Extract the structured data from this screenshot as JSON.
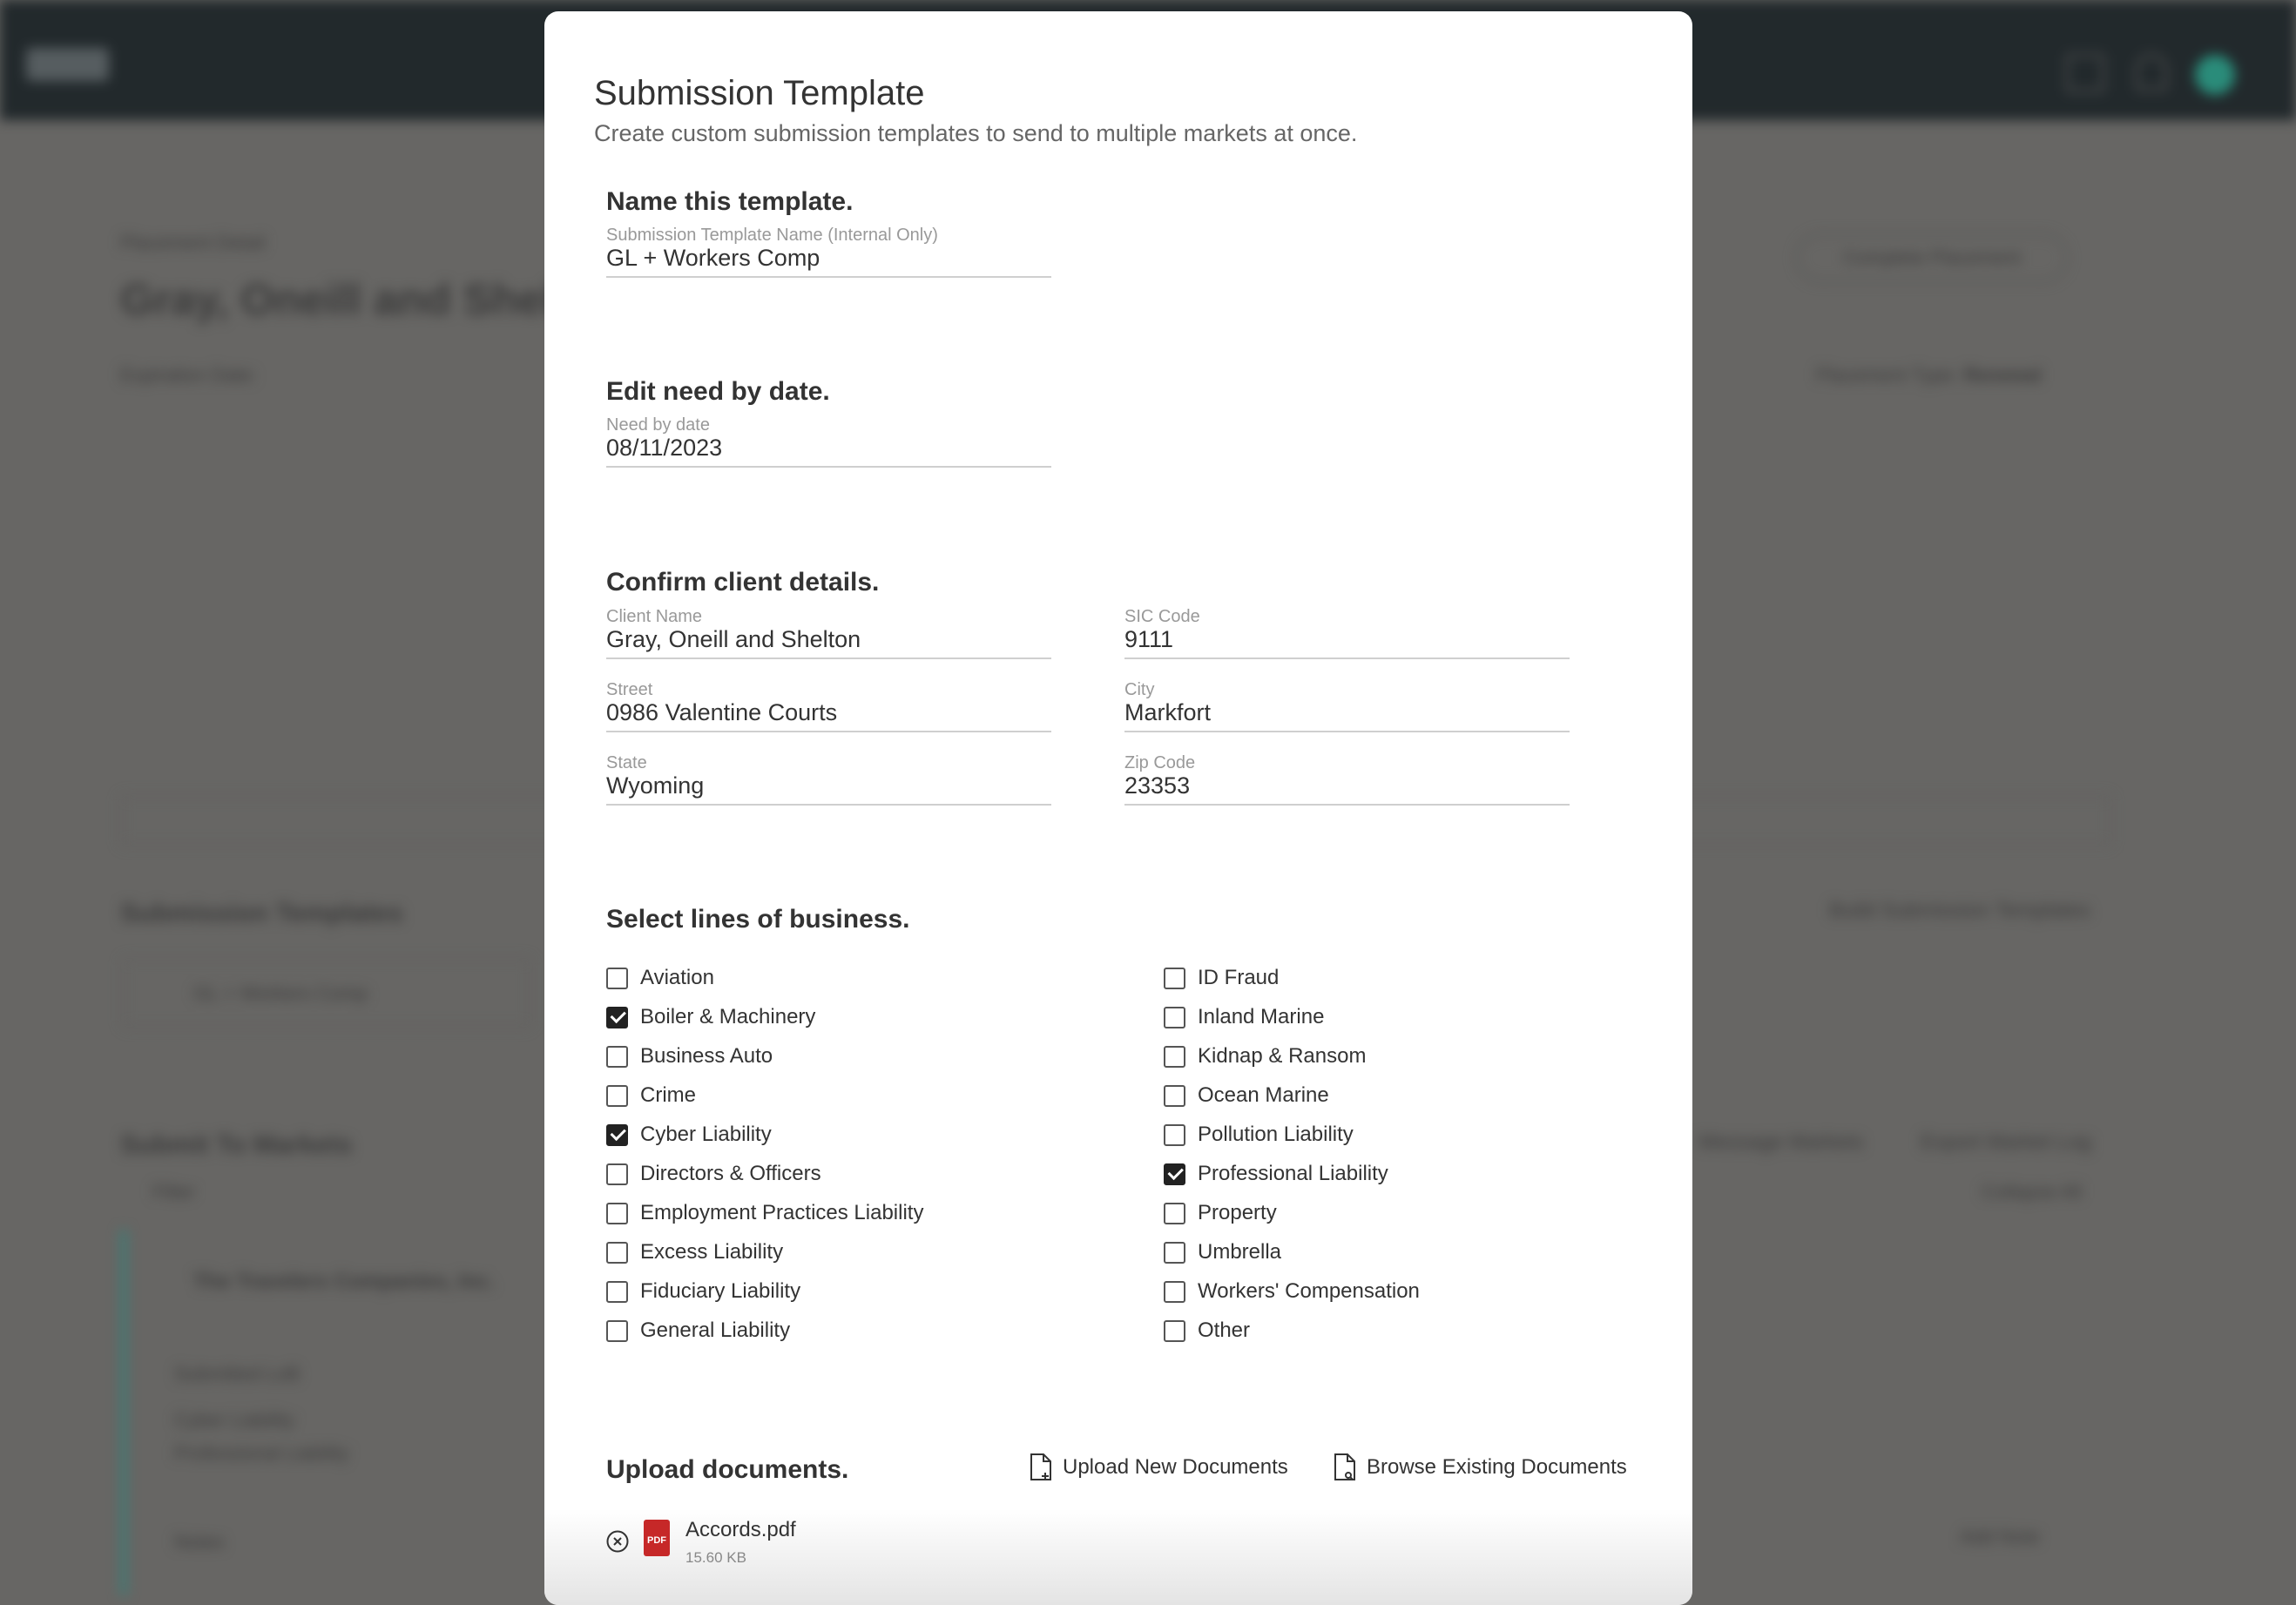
{
  "background": {
    "breadcrumb": "Placement Detail",
    "client_title": "Gray, Oneill and Shelton",
    "expiration_label": "Expiration Date:",
    "complete_button": "Complete Placement",
    "placement_type_label": "Placement Type:",
    "placement_type_value": "Renewal",
    "submission_templates_heading": "Submission Templates",
    "build_templates_button": "Build Submission Templates",
    "template_card": "GL + Workers Comp",
    "submit_markets_heading": "Submit To Markets",
    "filter_label": "Filter",
    "message_markets": "Message Markets",
    "export_log": "Export Market Log",
    "collapse_all": "Collapse All",
    "market_name": "The Travelers Companies, Inc.",
    "submitted_lob_label": "Submitted LoB",
    "lob_items": [
      "Cyber Liability",
      "Professional Liability"
    ],
    "notes_label": "Notes",
    "add_note": "Add Note"
  },
  "colors": {
    "topbar": "#22292c",
    "overlay": "#676664",
    "avatar": "#2a8c7a",
    "pdf": "#c62828"
  },
  "modal": {
    "title": "Submission Template",
    "subtitle": "Create custom submission templates to send to multiple markets at once.",
    "name_section": {
      "heading": "Name this template.",
      "label": "Submission Template Name (Internal Only)",
      "value": "GL + Workers Comp"
    },
    "date_section": {
      "heading": "Edit need by date.",
      "label": "Need by date",
      "value": "08/11/2023"
    },
    "client_section": {
      "heading": "Confirm client details.",
      "fields": [
        {
          "label": "Client Name",
          "value": "Gray, Oneill and Shelton"
        },
        {
          "label": "SIC Code",
          "value": "9111"
        },
        {
          "label": "Street",
          "value": "0986 Valentine Courts"
        },
        {
          "label": "City",
          "value": "Markfort"
        },
        {
          "label": "State",
          "value": "Wyoming"
        },
        {
          "label": "Zip Code",
          "value": "23353"
        }
      ]
    },
    "lob_section": {
      "heading": "Select lines of business.",
      "left": [
        {
          "label": "Aviation",
          "checked": false
        },
        {
          "label": "Boiler & Machinery",
          "checked": true
        },
        {
          "label": "Business Auto",
          "checked": false
        },
        {
          "label": "Crime",
          "checked": false
        },
        {
          "label": "Cyber Liability",
          "checked": true
        },
        {
          "label": "Directors & Officers",
          "checked": false
        },
        {
          "label": "Employment Practices Liability",
          "checked": false
        },
        {
          "label": "Excess Liability",
          "checked": false
        },
        {
          "label": "Fiduciary Liability",
          "checked": false
        },
        {
          "label": "General Liability",
          "checked": false
        }
      ],
      "right": [
        {
          "label": "ID Fraud",
          "checked": false
        },
        {
          "label": "Inland Marine",
          "checked": false
        },
        {
          "label": "Kidnap & Ransom",
          "checked": false
        },
        {
          "label": "Ocean Marine",
          "checked": false
        },
        {
          "label": "Pollution Liability",
          "checked": false
        },
        {
          "label": "Professional Liability",
          "checked": true
        },
        {
          "label": "Property",
          "checked": false
        },
        {
          "label": "Umbrella",
          "checked": false
        },
        {
          "label": "Workers' Compensation",
          "checked": false
        },
        {
          "label": "Other",
          "checked": false
        }
      ]
    },
    "upload_section": {
      "heading": "Upload documents.",
      "upload_new": "Upload New Documents",
      "browse_existing": "Browse Existing Documents",
      "files": [
        {
          "name": "Accords.pdf",
          "size": "15.60 KB",
          "icon_text": "PDF"
        }
      ]
    }
  }
}
